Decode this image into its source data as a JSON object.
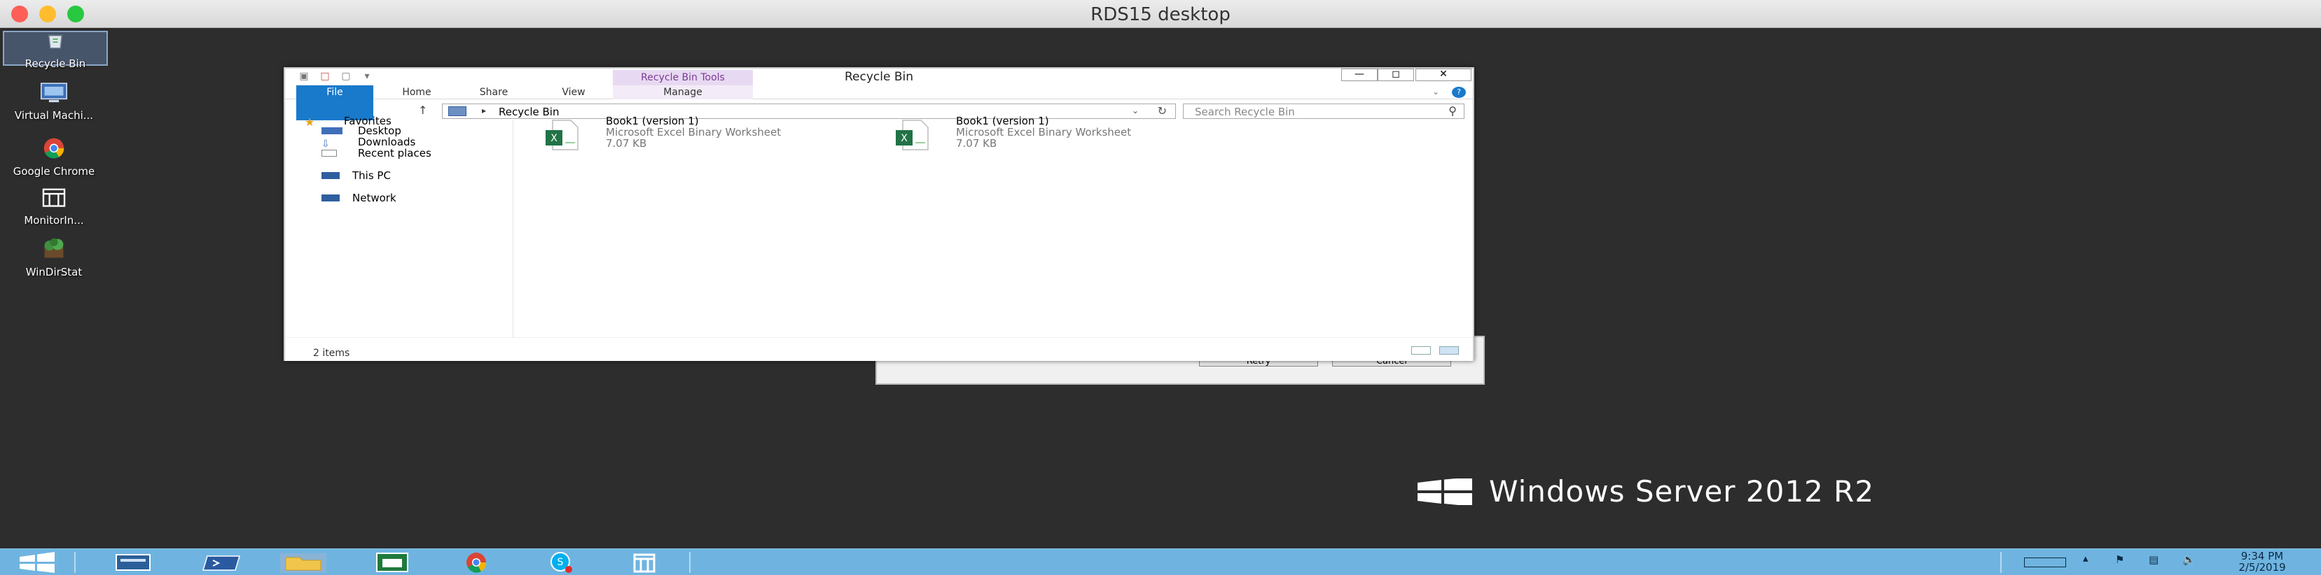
{
  "mac": {
    "title": "RDS15 desktop",
    "close_color": "#fe5f57",
    "min_color": "#febc2e",
    "max_color": "#28c840"
  },
  "desktop_icons": [
    {
      "label": "Recycle Bin",
      "icon": "recycle-bin-icon"
    },
    {
      "label": "Virtual Machi...",
      "icon": "virtual-machine-icon"
    },
    {
      "label": "Google Chrome",
      "icon": "chrome-icon"
    },
    {
      "label": "MonitorIn...",
      "icon": "monitor-app-icon"
    },
    {
      "label": "WinDirStat",
      "icon": "windirstat-icon"
    }
  ],
  "brand": {
    "text": "Windows Server 2012 R2"
  },
  "explorer": {
    "title": "Recycle Bin",
    "context_tab": "Recycle Bin Tools",
    "ribbon_tabs": [
      "File",
      "Home",
      "Share",
      "View",
      "Manage"
    ],
    "address": {
      "path": "Recycle Bin"
    },
    "search": {
      "placeholder": "Search Recycle Bin"
    },
    "nav": {
      "favorites": "Favorites",
      "favorites_items": [
        "Desktop",
        "Downloads",
        "Recent places"
      ],
      "this_pc": "This PC",
      "network": "Network"
    },
    "files": [
      {
        "name": "Book1 (version 1)",
        "type": "Microsoft Excel Binary Worksheet",
        "size": "7.07 KB"
      },
      {
        "name": "Book1 (version 1)",
        "type": "Microsoft Excel Binary Worksheet",
        "size": "7.07 KB"
      }
    ],
    "status": "2 items"
  },
  "back_dialog": {
    "retry": "Retry",
    "cancel": "Cancel"
  },
  "taskbar": {
    "apps": [
      "start-icon",
      "server-manager-icon",
      "powershell-icon",
      "file-explorer-icon",
      "spreadsheet-icon",
      "chrome-icon",
      "skype-icon",
      "monitor-app-icon"
    ],
    "clock_time": "9:34 PM",
    "clock_date": "2/5/2019",
    "accent": "#6fb4e0"
  }
}
